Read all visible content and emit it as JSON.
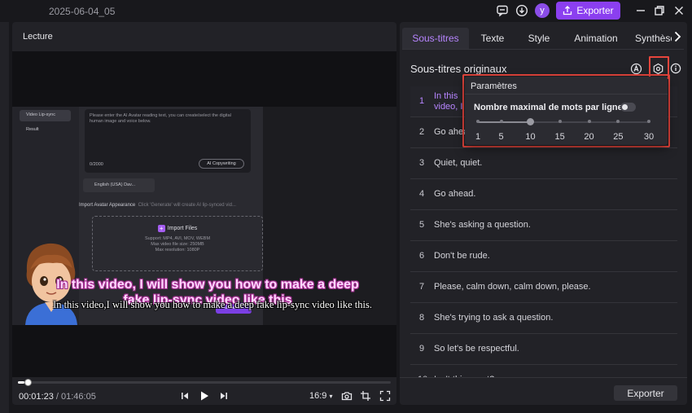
{
  "window": {
    "title": "2025-06-04_05",
    "avatar_letter": "y",
    "export_label": "Exporter"
  },
  "player": {
    "title": "Lecture",
    "current_time": "00:01:23",
    "separator": "/",
    "duration": "01:46:05",
    "aspect_ratio": "16:9",
    "progress_fraction": 0.018
  },
  "video": {
    "sidebar_items": [
      "Video Lip-sync",
      "Result"
    ],
    "prompt_text": "Please enter the AI Avatar reading text, you can create/select the digital human image and voice below.",
    "char_count": "0/2000",
    "ai_button": "AI Copywriting",
    "voice": "English (USA) Dav...",
    "import_title": "Import Avatar Appearance",
    "import_hint": "Click 'Generate' will create AI lip-synced vid...",
    "import_files": "Import Files",
    "support": "Support: MP4, AVI, MOV, WEBM",
    "max_size": "Max video file size: 250MB",
    "max_res": "Max resolution: 1080P",
    "generate": "Generate",
    "subtitle_styled": "In this video, I will show you how to make a deep fake lip-sync video like this",
    "subtitle_plain": "In this video,I will show you how to make a deep fake lip-sync video like this."
  },
  "right_panel": {
    "tabs": [
      "Sous-titres",
      "Texte",
      "Style",
      "Animation",
      "Synthèse"
    ],
    "active_tab": 0,
    "section_title": "Sous-titres originaux",
    "rows": [
      {
        "num": "1",
        "text": "In this video, I will show you how to make a deep fake lip sync video like this"
      },
      {
        "num": "2",
        "text": "Go ahead."
      },
      {
        "num": "3",
        "text": "Quiet, quiet."
      },
      {
        "num": "4",
        "text": "Go ahead."
      },
      {
        "num": "5",
        "text": "She's asking a question."
      },
      {
        "num": "6",
        "text": "Don't be rude."
      },
      {
        "num": "7",
        "text": "Please, calm down, calm down, please."
      },
      {
        "num": "8",
        "text": "She's trying to ask a question."
      },
      {
        "num": "9",
        "text": "So let's be respectful."
      },
      {
        "num": "10",
        "text": "Isn't this great?"
      }
    ],
    "export_label": "Exporter"
  },
  "settings_popover": {
    "title": "Paramètres",
    "max_words_label": "Nombre maximal de mots par ligne",
    "toggle_on": false,
    "ticks": [
      "1",
      "5",
      "10",
      "15",
      "20",
      "25",
      "30"
    ],
    "value": 10
  },
  "colors": {
    "accent": "#8b3ff0",
    "highlight": "#e6453c",
    "selected_text": "#b785ff"
  }
}
